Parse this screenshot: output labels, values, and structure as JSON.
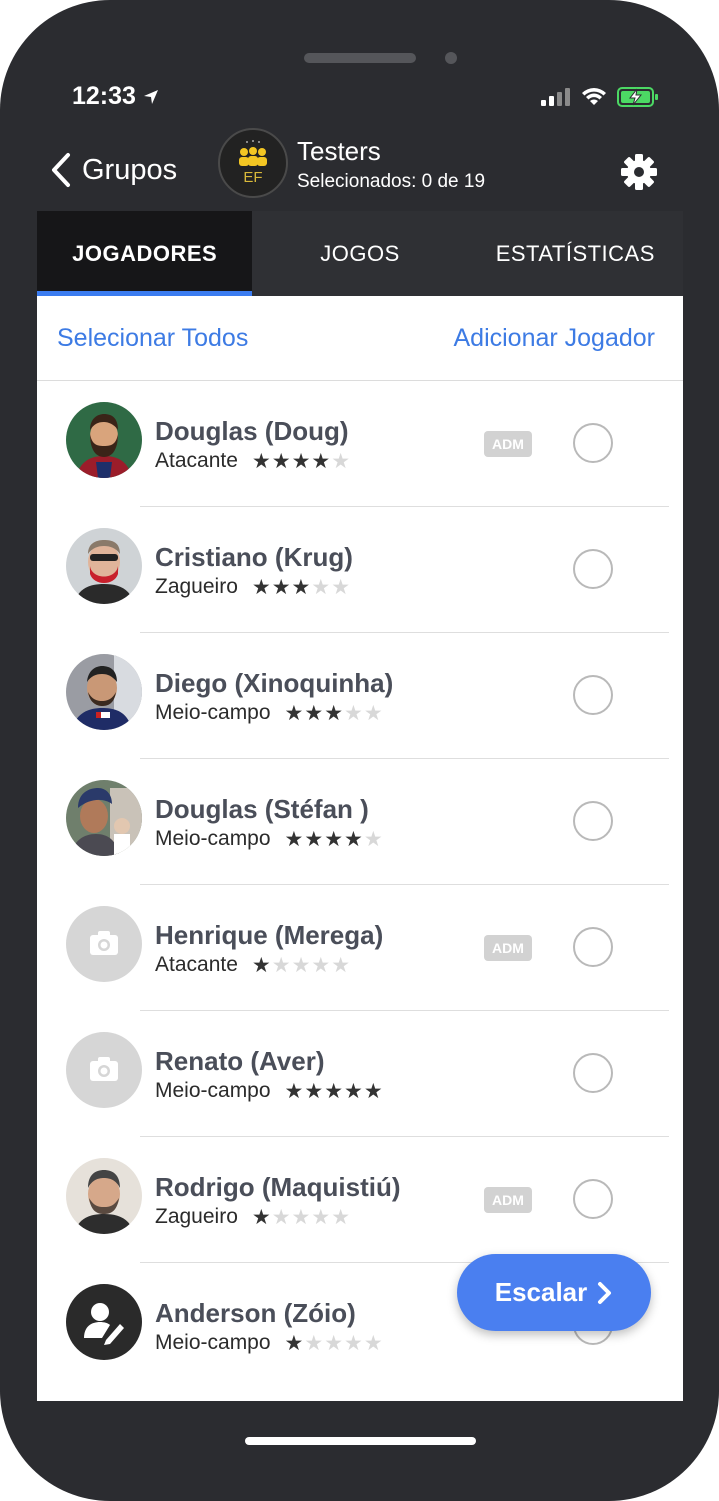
{
  "status": {
    "time": "12:33"
  },
  "nav": {
    "back_label": "Grupos",
    "group_title": "Testers",
    "group_subtitle": "Selecionados: 0 de 19",
    "group_logo_text": "EF"
  },
  "tabs": [
    {
      "label": "JOGADORES",
      "active": true
    },
    {
      "label": "JOGOS",
      "active": false
    },
    {
      "label": "ESTATÍSTICAS",
      "active": false
    }
  ],
  "actions": {
    "select_all": "Selecionar Todos",
    "add_player": "Adicionar Jogador"
  },
  "adm_label": "ADM",
  "players": [
    {
      "name": "Douglas (Doug)",
      "position": "Atacante",
      "rating": 4,
      "adm": true,
      "avatar": "photo"
    },
    {
      "name": "Cristiano (Krug)",
      "position": "Zagueiro",
      "rating": 3,
      "adm": false,
      "avatar": "photo"
    },
    {
      "name": "Diego (Xinoquinha)",
      "position": "Meio-campo",
      "rating": 3,
      "adm": false,
      "avatar": "photo"
    },
    {
      "name": "Douglas (Stéfan )",
      "position": "Meio-campo",
      "rating": 4,
      "adm": false,
      "avatar": "photo"
    },
    {
      "name": "Henrique (Merega)",
      "position": "Atacante",
      "rating": 1,
      "adm": true,
      "avatar": "camera-icon"
    },
    {
      "name": "Renato (Aver)",
      "position": "Meio-campo",
      "rating": 5,
      "adm": false,
      "avatar": "camera-icon"
    },
    {
      "name": "Rodrigo (Maquistiú)",
      "position": "Zagueiro",
      "rating": 1,
      "adm": true,
      "avatar": "photo"
    },
    {
      "name": "Anderson (Zóio)",
      "position": "Meio-campo",
      "rating": 1,
      "adm": false,
      "avatar": "user-edit-icon"
    }
  ],
  "fab": {
    "label": "Escalar"
  },
  "colors": {
    "accent": "#3d7be4",
    "tab_indicator": "#3b7cf0",
    "fab": "#4a7ff0",
    "battery": "#4cd964"
  }
}
